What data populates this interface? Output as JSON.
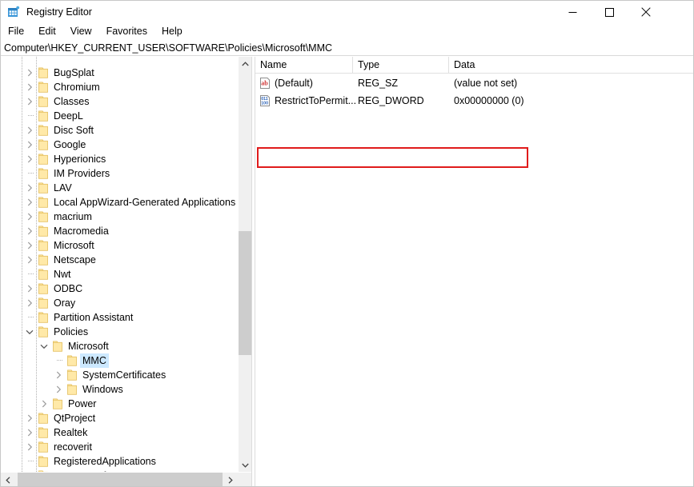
{
  "window": {
    "title": "Registry Editor",
    "app_icon": "registry-editor-icon",
    "controls": {
      "minimize": "minimize-icon",
      "maximize": "maximize-icon",
      "close": "close-icon"
    }
  },
  "menubar": {
    "items": [
      {
        "label": "File"
      },
      {
        "label": "Edit"
      },
      {
        "label": "View"
      },
      {
        "label": "Favorites"
      },
      {
        "label": "Help"
      }
    ]
  },
  "addressbar": {
    "path": "Computer\\HKEY_CURRENT_USER\\SOFTWARE\\Policies\\Microsoft\\MMC"
  },
  "tree": {
    "items": [
      {
        "label": "BugSplat",
        "depth": 1,
        "expander": "chevron-right",
        "selected": false
      },
      {
        "label": "Chromium",
        "depth": 1,
        "expander": "chevron-right",
        "selected": false
      },
      {
        "label": "Classes",
        "depth": 1,
        "expander": "chevron-right",
        "selected": false
      },
      {
        "label": "DeepL",
        "depth": 1,
        "expander": "none",
        "selected": false
      },
      {
        "label": "Disc Soft",
        "depth": 1,
        "expander": "chevron-right",
        "selected": false
      },
      {
        "label": "Google",
        "depth": 1,
        "expander": "chevron-right",
        "selected": false
      },
      {
        "label": "Hyperionics",
        "depth": 1,
        "expander": "chevron-right",
        "selected": false
      },
      {
        "label": "IM Providers",
        "depth": 1,
        "expander": "none",
        "selected": false
      },
      {
        "label": "LAV",
        "depth": 1,
        "expander": "chevron-right",
        "selected": false
      },
      {
        "label": "Local AppWizard-Generated Applications",
        "depth": 1,
        "expander": "chevron-right",
        "selected": false
      },
      {
        "label": "macrium",
        "depth": 1,
        "expander": "chevron-right",
        "selected": false
      },
      {
        "label": "Macromedia",
        "depth": 1,
        "expander": "chevron-right",
        "selected": false
      },
      {
        "label": "Microsoft",
        "depth": 1,
        "expander": "chevron-right",
        "selected": false
      },
      {
        "label": "Netscape",
        "depth": 1,
        "expander": "chevron-right",
        "selected": false
      },
      {
        "label": "Nwt",
        "depth": 1,
        "expander": "none",
        "selected": false
      },
      {
        "label": "ODBC",
        "depth": 1,
        "expander": "chevron-right",
        "selected": false
      },
      {
        "label": "Oray",
        "depth": 1,
        "expander": "chevron-right",
        "selected": false
      },
      {
        "label": "Partition Assistant",
        "depth": 1,
        "expander": "none",
        "selected": false
      },
      {
        "label": "Policies",
        "depth": 1,
        "expander": "chevron-down",
        "selected": false
      },
      {
        "label": "Microsoft",
        "depth": 2,
        "expander": "chevron-down",
        "selected": false
      },
      {
        "label": "MMC",
        "depth": 3,
        "expander": "none",
        "selected": true
      },
      {
        "label": "SystemCertificates",
        "depth": 3,
        "expander": "chevron-right",
        "selected": false
      },
      {
        "label": "Windows",
        "depth": 3,
        "expander": "chevron-right",
        "selected": false
      },
      {
        "label": "Power",
        "depth": 2,
        "expander": "chevron-right",
        "selected": false
      },
      {
        "label": "QtProject",
        "depth": 1,
        "expander": "chevron-right",
        "selected": false
      },
      {
        "label": "Realtek",
        "depth": 1,
        "expander": "chevron-right",
        "selected": false
      },
      {
        "label": "recoverit",
        "depth": 1,
        "expander": "chevron-right",
        "selected": false
      },
      {
        "label": "RegisteredApplications",
        "depth": 1,
        "expander": "none",
        "selected": false
      },
      {
        "label": "Scooter Software",
        "depth": 1,
        "expander": "chevron-right",
        "selected": false
      }
    ],
    "scrollbar": {
      "vertical_up": "chevron-up-icon",
      "vertical_down": "chevron-down-icon",
      "horizontal_left": "chevron-left-icon",
      "horizontal_right": "chevron-right-icon"
    }
  },
  "list": {
    "columns": [
      {
        "label": "Name"
      },
      {
        "label": "Type"
      },
      {
        "label": "Data"
      }
    ],
    "rows": [
      {
        "icon": "string-value-icon",
        "name": "(Default)",
        "type": "REG_SZ",
        "data": "(value not set)",
        "highlighted": false
      },
      {
        "icon": "dword-value-icon",
        "name": "RestrictToPermit...",
        "type": "REG_DWORD",
        "data": "0x00000000 (0)",
        "highlighted": true
      }
    ]
  },
  "annotation": {
    "type": "rectangle-highlight",
    "color": "#e01b1b",
    "target": "RestrictToPermit..."
  },
  "colors": {
    "selection": "#cce8ff",
    "folder": "#ffe9a8",
    "folder_border": "#e3bd5a",
    "annotation_red": "#e01b1b",
    "string_icon_red": "#d03030",
    "dword_icon_blue": "#2a62b8"
  }
}
